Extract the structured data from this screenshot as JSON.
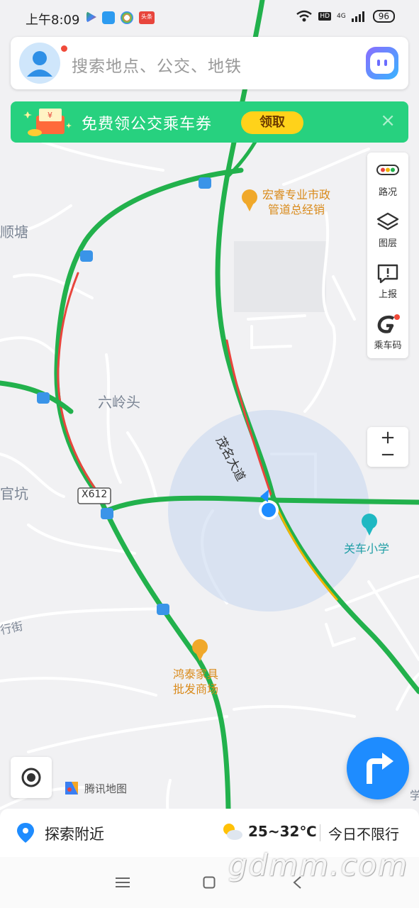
{
  "status_bar": {
    "time": "上午8:09",
    "network": "4G",
    "hd_label": "HD",
    "battery": "96",
    "notif_badge": "头条"
  },
  "search": {
    "placeholder": "搜索地点、公交、地铁"
  },
  "promo": {
    "text": "免费领公交乘车券",
    "button": "领取",
    "close": "×"
  },
  "tools": {
    "traffic": "路况",
    "layers": "图层",
    "report": "上报",
    "ride_code": "乘车码"
  },
  "zoom": {
    "plus": "+",
    "minus": "−"
  },
  "map": {
    "labels": {
      "shuntang": "顺塘",
      "liulingtou": "六岭头",
      "guankeng": "官坑",
      "x612": "X612",
      "hongrui_line1": "宏睿专业市政",
      "hongrui_line2": "管道总经销",
      "maoming_road": "茂名大道",
      "guanche_school": "关车小学",
      "hongtai_line1": "鸿泰家具",
      "hongtai_line2": "批发商场",
      "street": "行街",
      "xue": "学"
    },
    "attribution": "腾讯地图"
  },
  "bottom": {
    "explore": "探索附近",
    "temperature": "25~32℃",
    "restriction": "今日不限行"
  },
  "watermark": "gdmm.com",
  "colors": {
    "traffic_green": "#22b14c",
    "traffic_red": "#e8453c",
    "traffic_yellow": "#f0b400",
    "accent_blue": "#1e8cff",
    "promo_green": "#27d17f"
  }
}
